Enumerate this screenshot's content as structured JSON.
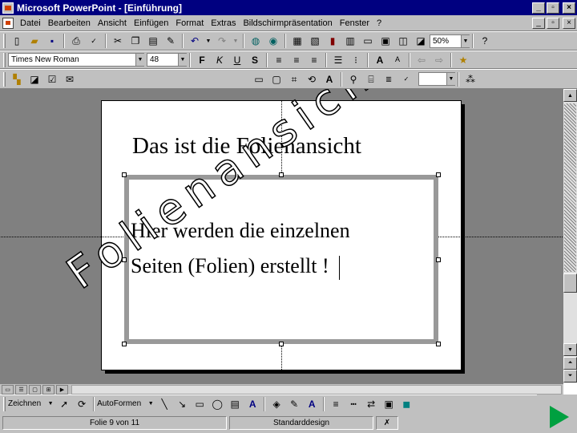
{
  "window": {
    "title": "Microsoft PowerPoint - [Einführung]",
    "minimize": "_",
    "restore": "▫",
    "close": "×"
  },
  "menubar": {
    "items": [
      "Datei",
      "Bearbeiten",
      "Ansicht",
      "Einfügen",
      "Format",
      "Extras",
      "Bildschirmpräsentation",
      "Fenster",
      "?"
    ],
    "minimize": "_",
    "restore": "▫",
    "close": "×"
  },
  "toolbar_standard": {
    "zoom": "50%"
  },
  "toolbar_format": {
    "font": "Times New Roman",
    "size": "48",
    "bold": "F",
    "italic": "K",
    "underline": "U",
    "shadow": "S"
  },
  "slide": {
    "title": "Das ist die Folienansicht",
    "body_line1": "Hier werden die einzelnen",
    "body_line2": "Seiten (Folien) erstellt !"
  },
  "watermark": "Folienansicht",
  "drawing_toolbar": {
    "draw_menu": "Zeichnen",
    "autoshapes_menu": "AutoFormen"
  },
  "statusbar": {
    "slide_position": "Folie 9 von 11",
    "design": "Standarddesign"
  },
  "icons": [
    "new-icon",
    "open-icon",
    "save-icon",
    "print-icon",
    "spelling-icon",
    "cut-icon",
    "copy-icon",
    "paste-icon",
    "format-painter-icon",
    "undo-icon",
    "redo-icon",
    "hyperlink-icon",
    "web-toolbar-icon",
    "play-icon"
  ],
  "colors": {
    "titlebar": "#000080",
    "chrome": "#c0c0c0",
    "workspace": "#808080",
    "slideshow_arrow": "#00a040"
  }
}
